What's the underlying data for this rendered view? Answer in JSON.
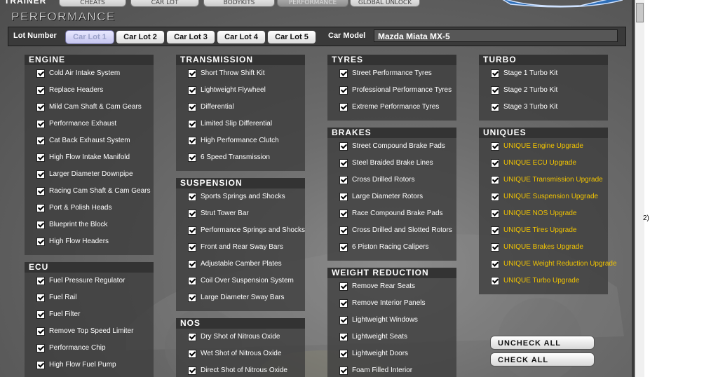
{
  "top_tabs": {
    "trainer": "TRAINER",
    "tabs": [
      "CHEATS",
      "CAR LOT",
      "BODYKITS",
      "PERFORMANCE",
      "GLOBAL UNLOCK"
    ],
    "active_index": 3
  },
  "page_title": "PERFORMANCE",
  "lot_bar": {
    "label": "Lot Number",
    "lots": [
      "Car Lot 1",
      "Car Lot 2",
      "Car Lot 3",
      "Car Lot 4",
      "Car Lot 5"
    ],
    "selected_index": 0,
    "model_label": "Car Model",
    "model_value": "Mazda Miata MX-5"
  },
  "panels": {
    "engine": {
      "title": "ENGINE",
      "items": [
        "Cold Air Intake System",
        "Replace Headers",
        "Mild Cam Shaft & Cam Gears",
        "Performance Exhaust",
        "Cat Back Exhaust System",
        "High Flow Intake Manifold",
        "Larger Diameter Downpipe",
        "Racing Cam Shaft & Cam Gears",
        "Port & Polish Heads",
        "Blueprint the Block",
        "High Flow Headers"
      ]
    },
    "ecu": {
      "title": "ECU",
      "items": [
        "Fuel Pressure Regulator",
        "Fuel Rail",
        "Fuel Filter",
        "Remove Top Speed Limiter",
        "Performance Chip",
        "High Flow Fuel Pump"
      ]
    },
    "transmission": {
      "title": "TRANSMISSION",
      "items": [
        "Short Throw Shift Kit",
        "Lightweight Flywheel",
        "Differential",
        "Limited Slip Differential",
        "High Performance Clutch",
        "6 Speed Transmission"
      ]
    },
    "suspension": {
      "title": "SUSPENSION",
      "items": [
        "Sports Springs and Shocks",
        "Strut Tower Bar",
        "Performance Springs and Shocks",
        "Front and Rear Sway Bars",
        "Adjustable Camber Plates",
        "Coil Over Suspension System",
        "Large Diameter Sway Bars"
      ]
    },
    "nos": {
      "title": "NOS",
      "items": [
        "Dry Shot of Nitrous Oxide",
        "Wet Shot of Nitrous Oxide",
        "Direct Shot of Nitrous Oxide"
      ]
    },
    "tyres": {
      "title": "TYRES",
      "items": [
        "Street Performance Tyres",
        "Professional Performance Tyres",
        "Extreme Performance Tyres"
      ]
    },
    "brakes": {
      "title": "BRAKES",
      "items": [
        "Street Compound Brake Pads",
        "Steel Braided Brake Lines",
        "Cross Drilled Rotors",
        "Large Diameter Rotors",
        "Race Compound Brake Pads",
        "Cross Drilled and Slotted Rotors",
        "6 Piston Racing Calipers"
      ]
    },
    "weight_reduction": {
      "title": "WEIGHT REDUCTION",
      "items": [
        "Remove Rear Seats",
        "Remove Interior Panels",
        "Lightweight Windows",
        "Lightweight Seats",
        "Lightweight Doors",
        "Foam Filled Interior"
      ]
    },
    "turbo": {
      "title": "TURBO",
      "items": [
        "Stage 1 Turbo Kit",
        "Stage 2 Turbo Kit",
        "Stage 3 Turbo Kit"
      ]
    },
    "uniques": {
      "title": "UNIQUES",
      "items": [
        "UNIQUE Engine Upgrade",
        "UNIQUE ECU Upgrade",
        "UNIQUE Transmission Upgrade",
        "UNIQUE Suspension Upgrade",
        "UNIQUE NOS Upgrade",
        "UNIQUE Tires Upgrade",
        "UNIQUE Brakes Upgrade",
        "UNIQUE Weight Reduction Upgrade",
        "UNIQUE Turbo Upgrade"
      ]
    }
  },
  "actions": {
    "uncheck_all": "UNCHECK ALL",
    "check_all": "CHECK ALL"
  },
  "side_text": "2)",
  "colors": {
    "unique_text": "#f2c400",
    "header_bg": "#333333",
    "panel_bg": "#3c3c3c"
  }
}
